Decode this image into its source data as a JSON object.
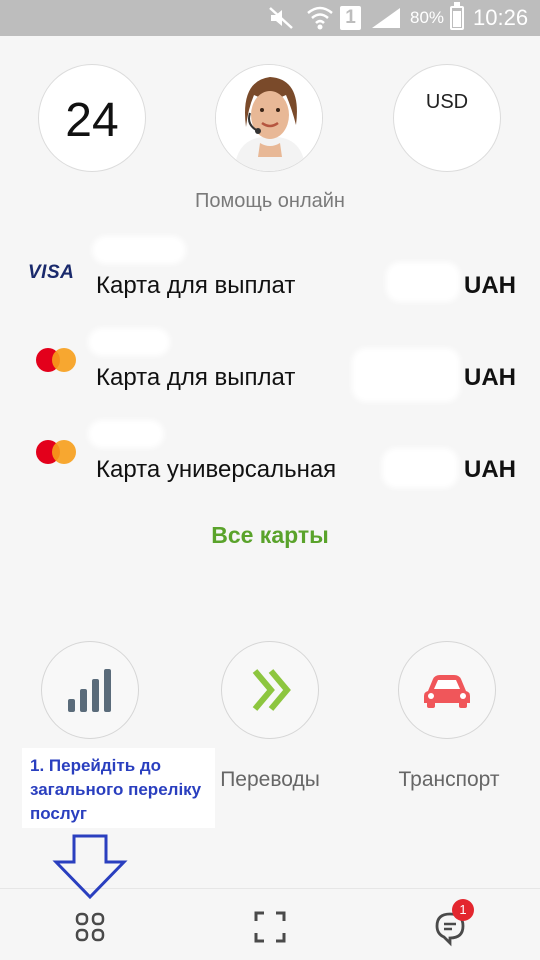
{
  "status_bar": {
    "icons": [
      "mute-icon",
      "wifi-icon",
      "sim-icon",
      "signal-icon",
      "battery-icon"
    ],
    "sim_slot": "1",
    "battery": "80%",
    "time": "10:26"
  },
  "header": {
    "day": "24",
    "currency": "USD",
    "help_label": "Помощь онлайн"
  },
  "cards": [
    {
      "brand": "VISA",
      "name": "Карта для выплат",
      "currency": "UAH"
    },
    {
      "brand": "mastercard",
      "name": "Карта для выплат",
      "currency": "UAH"
    },
    {
      "brand": "mastercard",
      "name": "Карта универсальная",
      "currency": "UAH"
    }
  ],
  "all_cards_link": "Все карты",
  "services": [
    {
      "icon": "signal-bars-icon",
      "label": ""
    },
    {
      "icon": "double-chevron-icon",
      "label": "Переводы"
    },
    {
      "icon": "car-icon",
      "label": "Транспорт"
    }
  ],
  "tooltip": {
    "text": "1. Перейдіть до загального переліку послуг"
  },
  "bottom_nav": {
    "items": [
      "catalog-icon",
      "scan-icon",
      "chat-icon"
    ],
    "chat_badge": "1"
  },
  "colors": {
    "accent_green": "#5aa32b",
    "transfer_green": "#8dc63f",
    "transport_red": "#f0565a",
    "tooltip_blue": "#2a3fbf",
    "badge_red": "#e3262e"
  }
}
